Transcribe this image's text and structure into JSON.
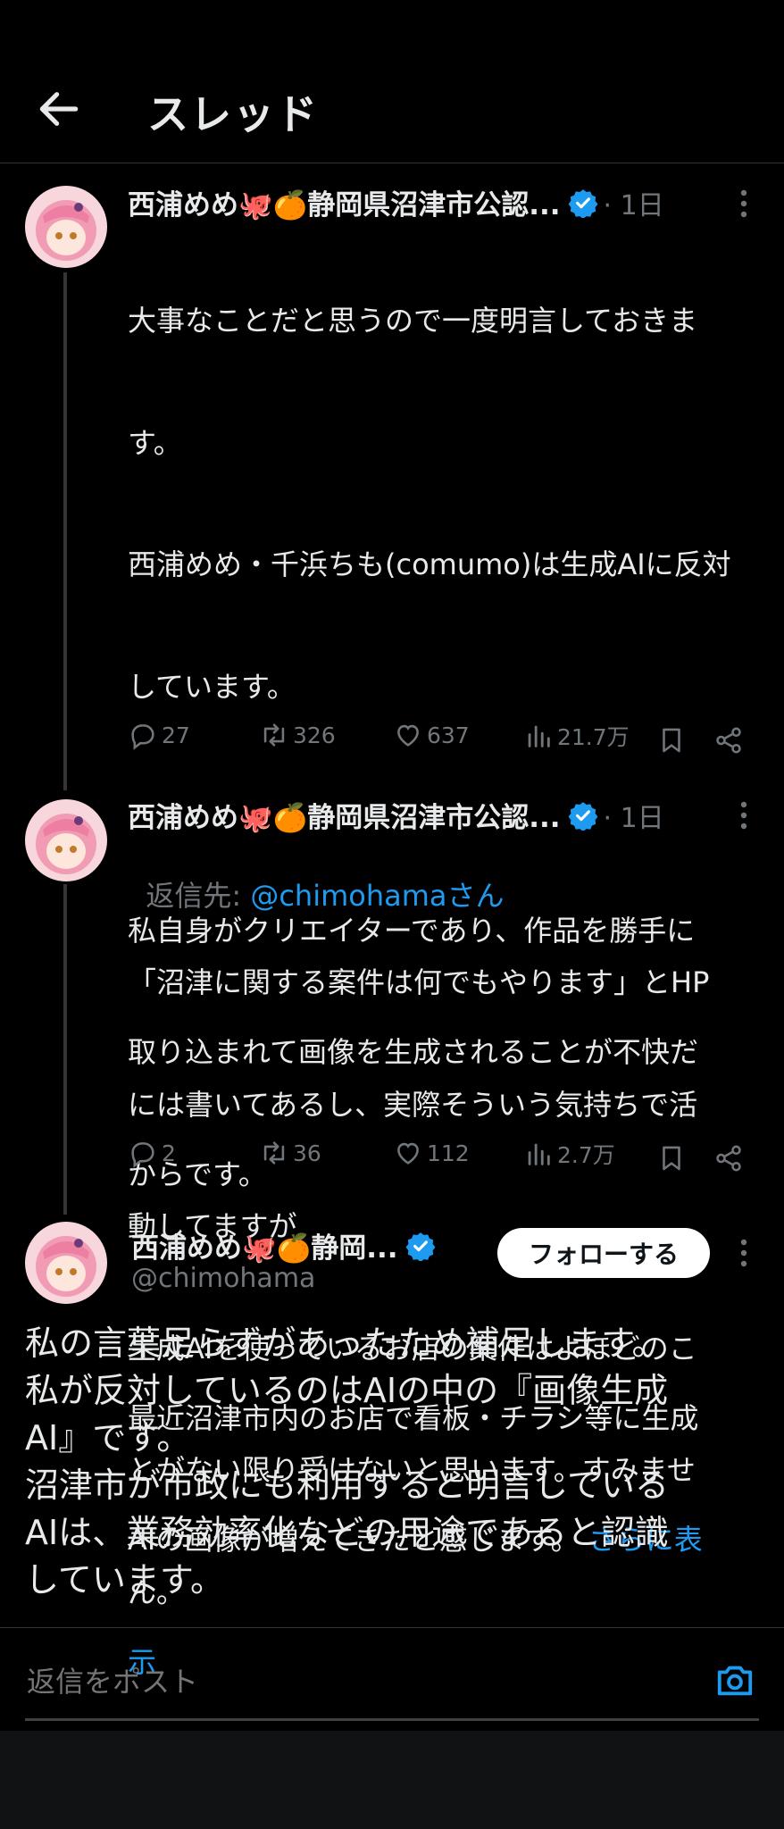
{
  "header": {
    "title": "スレッド",
    "back_icon": "arrow-left-icon"
  },
  "tweets": [
    {
      "name": "西浦めめ🐙🍊静岡県沼津市公認...",
      "meta": "· 1日",
      "lines": [
        "大事なことだと思うので一度明言しておきま",
        "す。",
        "西浦めめ・千浜ちも(comumo)は生成AIに反対",
        "しています。",
        "",
        "私自身がクリエイターであり、作品を勝手に",
        "取り込まれて画像を生成されることが不快だ",
        "からです。",
        "",
        "最近沼津市内のお店で看板・チラシ等に生成"
      ],
      "last_line": "AIの画像が増えてきたと感じます。",
      "more_link": "さらに表",
      "more_link2": "示",
      "replies": "27",
      "retweets": "326",
      "likes": "637",
      "views": "21.7万"
    },
    {
      "name": "西浦めめ🐙🍊静岡県沼津市公認...",
      "meta": "· 1日",
      "reply_prefix": "返信先: ",
      "reply_to": "@chimohamaさん",
      "lines": [
        "「沼津に関する案件は何でもやります」とHP",
        "には書いてあるし、実際そういう気持ちで活",
        "動してますが",
        "生成AIを使っているお店の案件はよほどのこ",
        "とがない限り受けないと思います。すみませ",
        "ん。"
      ],
      "replies": "2",
      "retweets": "36",
      "likes": "112",
      "views": "2.7万"
    }
  ],
  "main_tweet": {
    "name": "西浦めめ🐙🍊静岡...",
    "handle": "@chimohama",
    "follow_label": "フォローする",
    "text": "私の言葉足らずがあったため補足します。\n私が反対しているのはAIの中の『画像生成\nAI』です。\n沼津市が市政にも利用すると明言している\nAIは、業務効率化などの用途であると認識\nしています。"
  },
  "reply_bar": {
    "placeholder": "返信をポスト",
    "camera_icon": "camera-icon"
  },
  "colors": {
    "background": "#000000",
    "accent": "#1d9bf0",
    "muted": "#71767b",
    "text": "#e7e9ea"
  }
}
